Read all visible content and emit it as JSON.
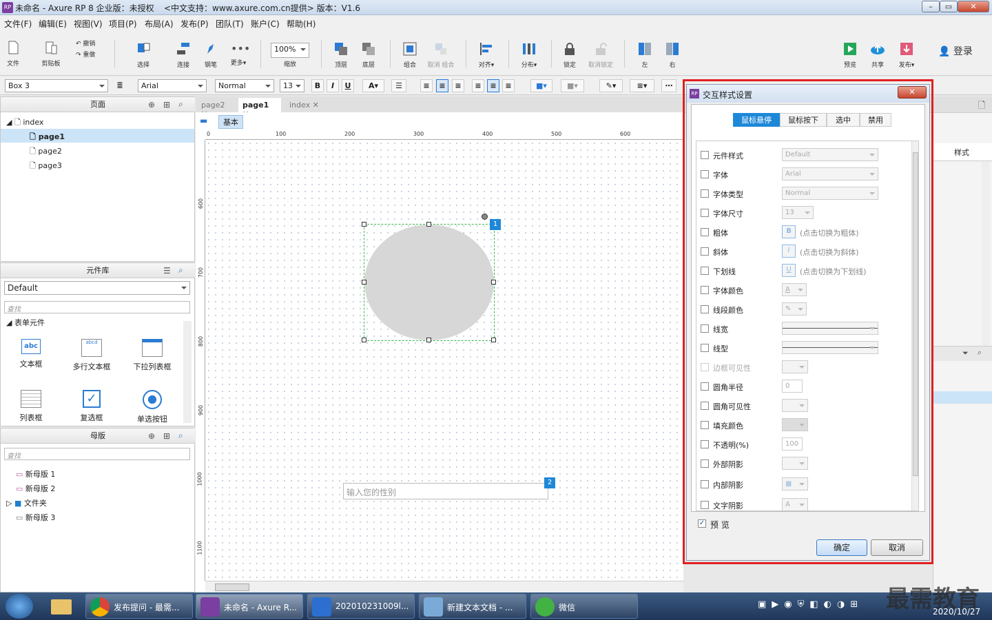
{
  "title": {
    "app": "未命名 - Axure RP 8 企业版：未授权",
    "support": "<中文支持：www.axure.com.cn提供> 版本：V1.6",
    "logo": "RP"
  },
  "menu": [
    "文件(F)",
    "编辑(E)",
    "视图(V)",
    "项目(P)",
    "布局(A)",
    "发布(P)",
    "团队(T)",
    "账户(C)",
    "帮助(H)"
  ],
  "toolbar": {
    "file": "文件",
    "clipboard": "剪贴板",
    "undo": "撤销",
    "redo": "重做",
    "select": "选择",
    "connect": "连接",
    "pen": "钢笔",
    "more": "更多▾",
    "zoom_value": "100%",
    "zoom": "缩放",
    "top": "顶层",
    "bottom": "底层",
    "group": "组合",
    "ungroup": "取消 组合",
    "align": "对齐▾",
    "distribute": "分布▾",
    "lock": "锁定",
    "unlock": "取消锁定",
    "left": "左",
    "right": "右",
    "preview": "预览",
    "share": "共享",
    "publish": "发布▾",
    "login": "登录"
  },
  "format": {
    "widget_name": "Box 3",
    "font": "Arial",
    "font_style": "Normal",
    "font_size": "13"
  },
  "pages_panel": {
    "title": "页面",
    "root": "index",
    "items": [
      "page1",
      "page2",
      "page3"
    ]
  },
  "library_panel": {
    "title": "元件库",
    "library": "Default",
    "search": "查找",
    "group": "表单元件",
    "widgets": [
      {
        "label": "文本框",
        "icon_text": "abc"
      },
      {
        "label": "多行文本框",
        "icon_text": "abcd"
      },
      {
        "label": "下拉列表框",
        "icon_text": ""
      },
      {
        "label": "列表框",
        "icon_text": ""
      },
      {
        "label": "复选框",
        "icon_text": ""
      },
      {
        "label": "单选按钮",
        "icon_text": ""
      }
    ]
  },
  "masters_panel": {
    "title": "母版",
    "search": "查找",
    "items": [
      "新母版 1",
      "新母版 2",
      "文件夹",
      "新母版 3"
    ]
  },
  "tabs": [
    "page2",
    "page1",
    "index"
  ],
  "canvas": {
    "adaptive_view": "基本",
    "ruler_h": [
      "0",
      "100",
      "200",
      "300",
      "400",
      "500",
      "600"
    ],
    "ruler_v": [
      "600",
      "700",
      "800",
      "900",
      "1000",
      "1100"
    ],
    "badge1": "1",
    "badge2": "2",
    "textbox_placeholder": "输入您的性别"
  },
  "right_panel": {
    "style": "样式"
  },
  "dialog": {
    "title": "交互样式设置",
    "logo": "RP",
    "tabs": [
      "鼠标悬停",
      "鼠标按下",
      "选中",
      "禁用"
    ],
    "rows": [
      {
        "label": "元件样式",
        "value": "Default"
      },
      {
        "label": "字体",
        "value": "Arial"
      },
      {
        "label": "字体类型",
        "value": "Normal"
      },
      {
        "label": "字体尺寸",
        "value": "13"
      },
      {
        "label": "粗体",
        "value": "(点击切换为粗体)",
        "btn": "B"
      },
      {
        "label": "斜体",
        "value": "(点击切换为斜体)",
        "btn": "I"
      },
      {
        "label": "下划线",
        "value": "(点击切换为下划线)",
        "btn": "U"
      },
      {
        "label": "字体颜色",
        "value": "A"
      },
      {
        "label": "线段颜色",
        "value": ""
      },
      {
        "label": "线宽",
        "value": ""
      },
      {
        "label": "线型",
        "value": ""
      },
      {
        "label": "边框可见性",
        "value": ""
      },
      {
        "label": "圆角半径",
        "value": "0"
      },
      {
        "label": "圆角可见性",
        "value": ""
      },
      {
        "label": "填充颜色",
        "value": ""
      },
      {
        "label": "不透明(%)",
        "value": "100"
      },
      {
        "label": "外部阴影",
        "value": ""
      },
      {
        "label": "内部阴影",
        "value": ""
      },
      {
        "label": "文字阴影",
        "value": "A"
      }
    ],
    "preview": "预 览",
    "ok": "确定",
    "cancel": "取消",
    "highlight_color": "#e02020"
  },
  "taskbar": {
    "items": [
      {
        "label": "发布提问 - 最需...",
        "color": "#e8e8e8"
      },
      {
        "label": "未命名 - Axure R...",
        "color": "#7a3fa0"
      },
      {
        "label": "202010231009l...",
        "color": "#2c6fd1"
      },
      {
        "label": "新建文本文档 - ...",
        "color": "#7aaad8"
      },
      {
        "label": "微信",
        "color": "#43b244"
      }
    ],
    "date": "2020/10/27",
    "watermark": "最需教育"
  }
}
